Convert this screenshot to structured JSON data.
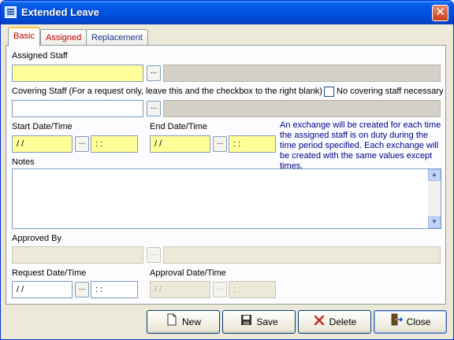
{
  "window": {
    "title": "Extended Leave",
    "close_glyph": "✕"
  },
  "tabs": [
    {
      "label": "Basic"
    },
    {
      "label": "Assigned"
    },
    {
      "label": "Replacement"
    }
  ],
  "assigned_staff": {
    "label": "Assigned Staff",
    "value": "",
    "name_value": "",
    "browse": "..."
  },
  "covering_staff": {
    "label": "Covering Staff (For a request only, leave this and the checkbox to the right blank)",
    "value": "",
    "name_value": "",
    "browse": "...",
    "no_covering_label": "No covering staff necessary",
    "no_covering_checked": false
  },
  "start": {
    "label": "Start Date/Time",
    "date": " /  /",
    "time": " :  :",
    "browse": "..."
  },
  "end": {
    "label": "End Date/Time",
    "date": " /  /",
    "time": " :  :",
    "browse": "..."
  },
  "info_text": "An exchange will be created for each time the assigned staff is on duty during the time period specified.  Each exchange will be created with the same values except times.",
  "notes": {
    "label": "Notes",
    "value": ""
  },
  "approved_by": {
    "label": "Approved By",
    "value": "",
    "name_value": "",
    "browse": "..."
  },
  "request": {
    "label": "Request Date/Time",
    "date": " /  /",
    "time": " :  :",
    "browse": "..."
  },
  "approval": {
    "label": "Approval Date/Time",
    "date": " /  /",
    "time": " :  :",
    "browse": "..."
  },
  "buttons": {
    "new": "New",
    "save": "Save",
    "delete": "Delete",
    "close": "Close"
  },
  "colors": {
    "title_bar": "#0054e3",
    "required_field": "#ffff99",
    "info_text": "#00008b",
    "active_tab_text": "#c00000"
  }
}
